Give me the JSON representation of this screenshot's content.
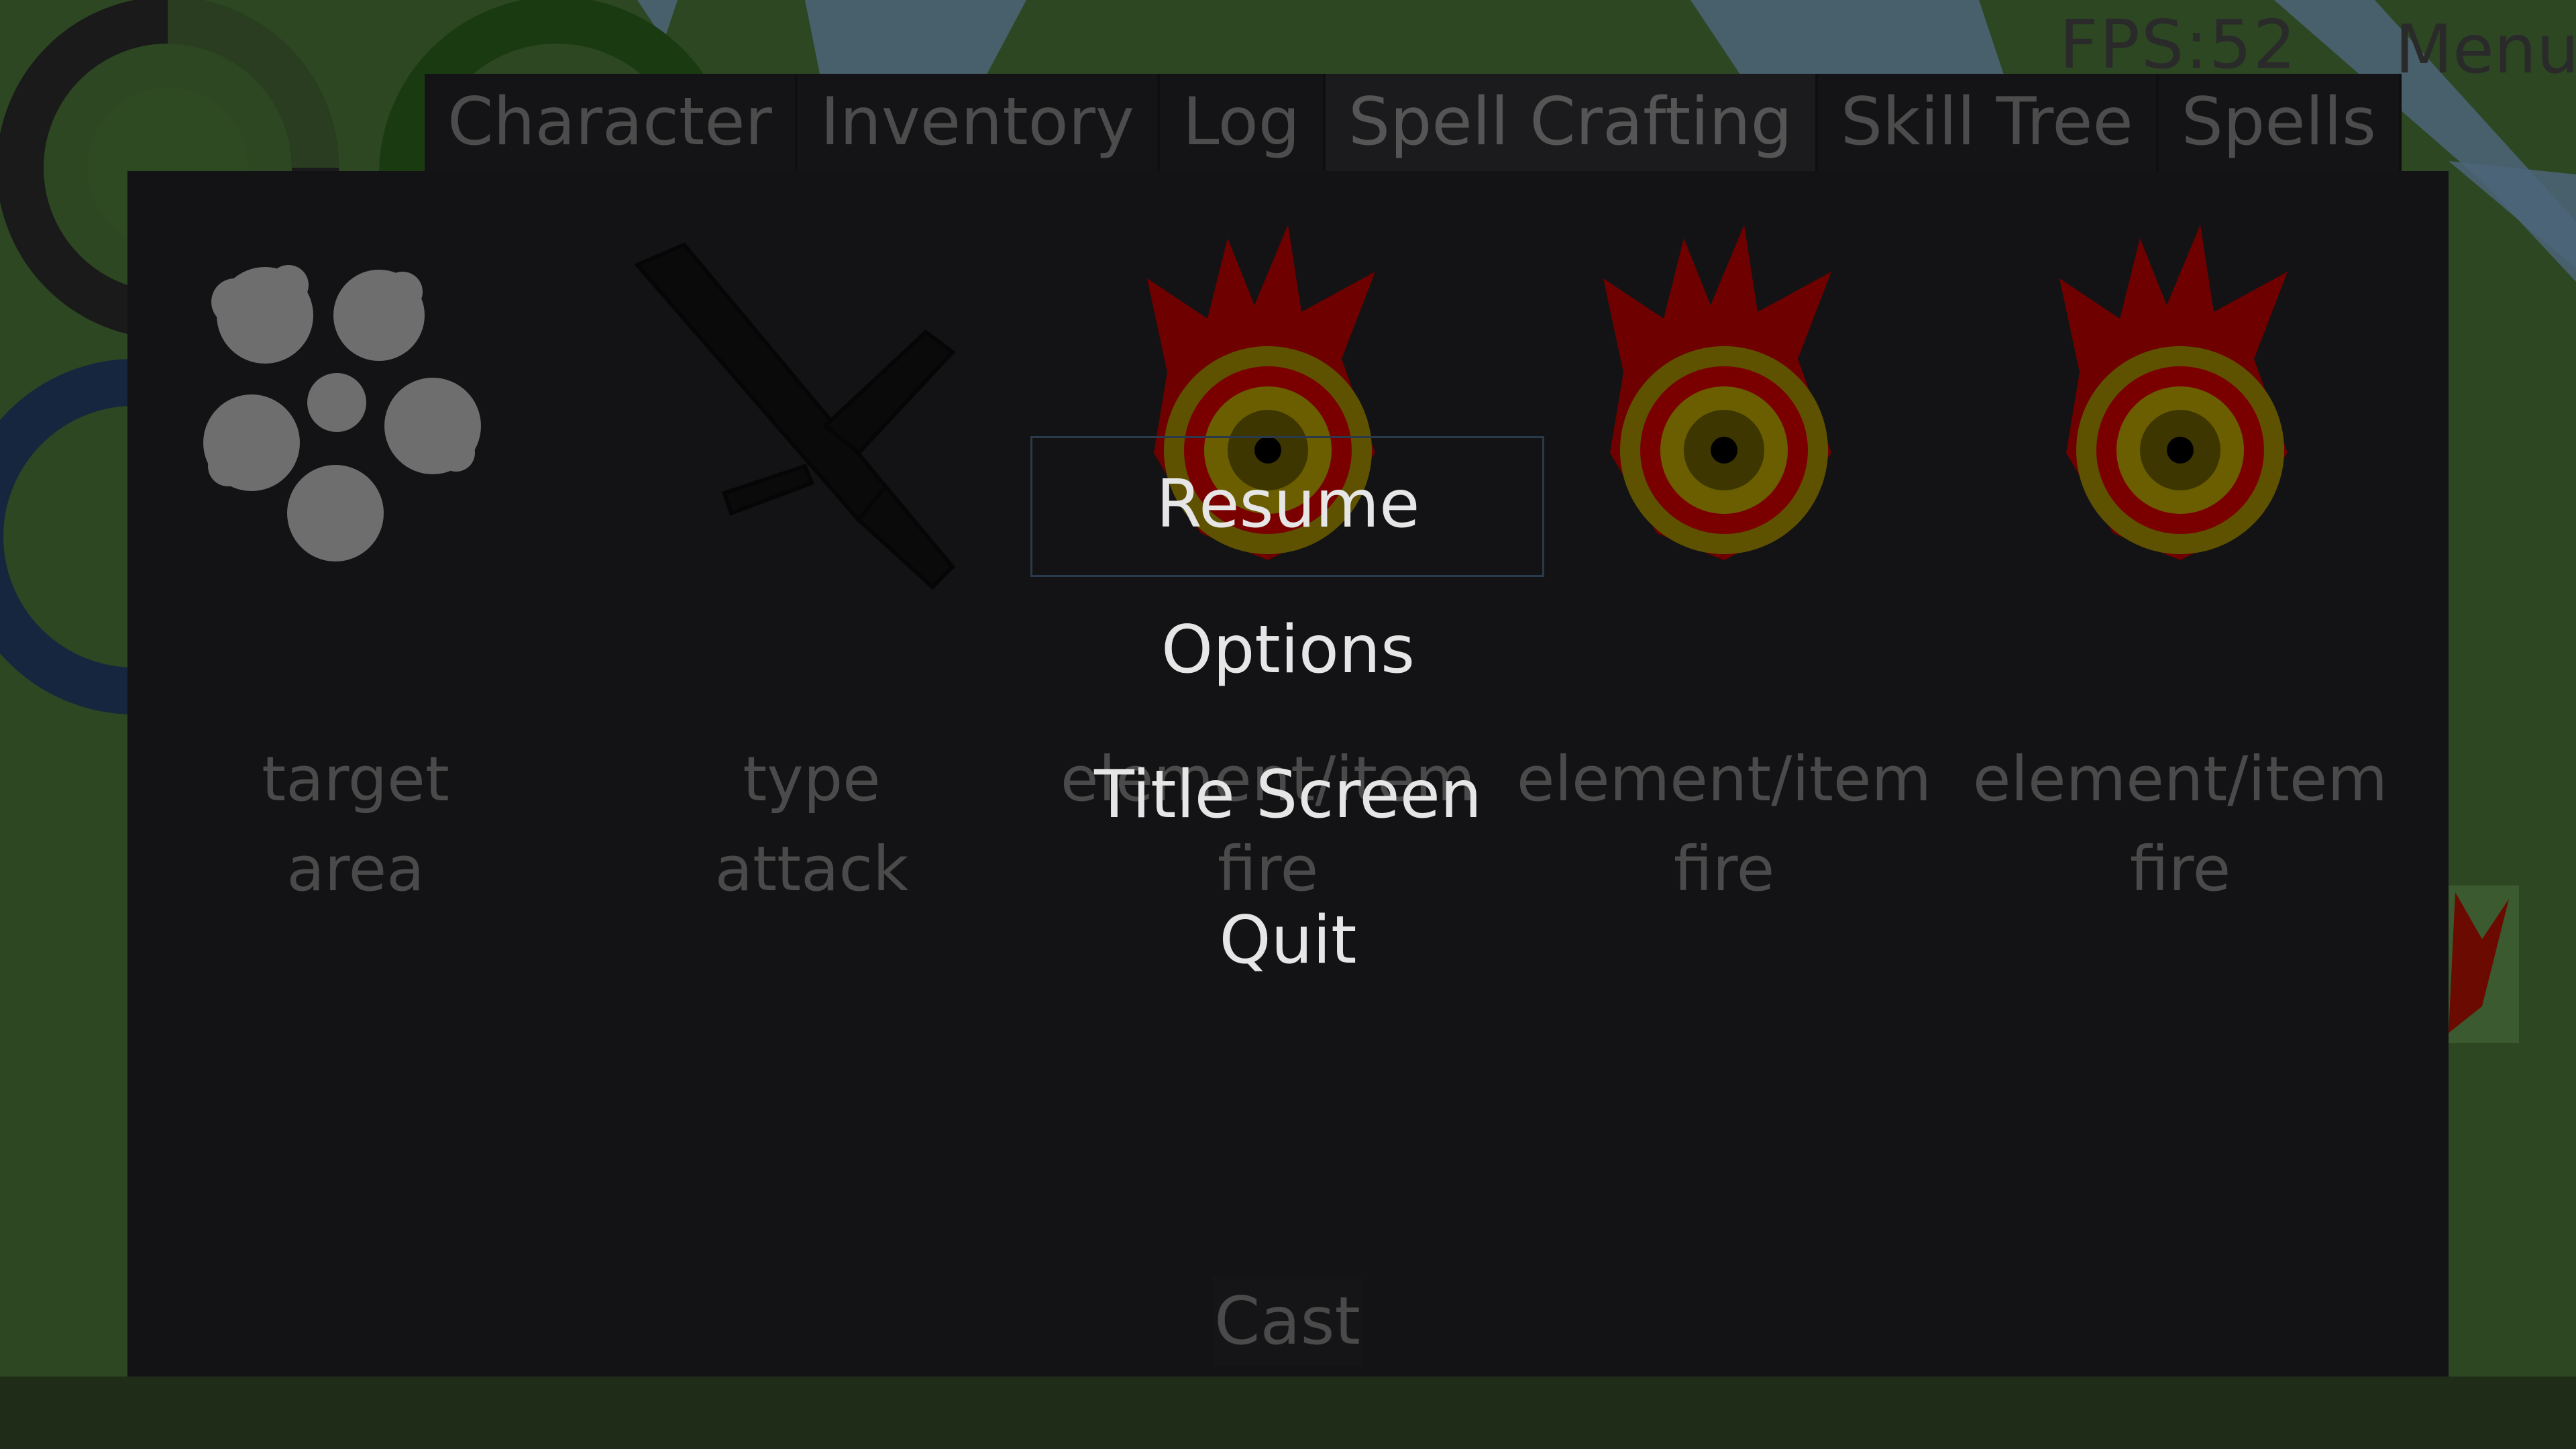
{
  "hud": {
    "fps": "FPS:52",
    "menu_label": "Menu"
  },
  "tabs": [
    {
      "label": "Character",
      "active": false
    },
    {
      "label": "Inventory",
      "active": false
    },
    {
      "label": "Log",
      "active": false
    },
    {
      "label": "Spell Crafting",
      "active": true
    },
    {
      "label": "Skill Tree",
      "active": false
    },
    {
      "label": "Spells",
      "active": false
    }
  ],
  "slots": [
    {
      "icon": "target-area-splat-icon",
      "line1": "target",
      "line2": "area"
    },
    {
      "icon": "sword-icon",
      "line1": "type",
      "line2": "attack"
    },
    {
      "icon": "fire-orb-icon",
      "line1": "element/item",
      "line2": "fire"
    },
    {
      "icon": "fire-orb-icon",
      "line1": "element/item",
      "line2": "fire"
    },
    {
      "icon": "fire-orb-icon",
      "line1": "element/item",
      "line2": "fire"
    }
  ],
  "cast_label": "Cast",
  "pause_menu": {
    "resume": "Resume",
    "options": "Options",
    "title_screen": "Title Screen",
    "quit": "Quit"
  },
  "colors": {
    "panel": "#131315",
    "fire_outer": "#7a0000",
    "fire_ring": "#7a6a00",
    "menu_text": "#e6e6e6"
  }
}
